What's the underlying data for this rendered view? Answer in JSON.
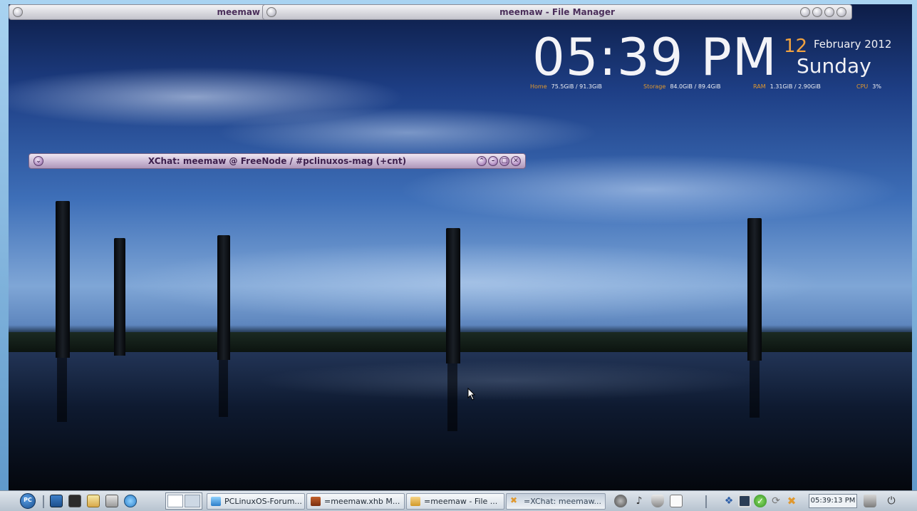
{
  "windows": {
    "meemaw_small_title": "meemaw",
    "file_manager_title": "meemaw - File Manager",
    "xchat_title": "XChat: meemaw @ FreeNode / #pclinuxos-mag (+cnt)"
  },
  "conky": {
    "time": "05:39 PM",
    "day": "12",
    "month_year": "February 2012",
    "weekday": "Sunday",
    "stats": [
      {
        "label": "Home",
        "value": "75.5GiB / 91.3GiB"
      },
      {
        "label": "Storage",
        "value": "84.0GiB / 89.4GiB"
      },
      {
        "label": "RAM",
        "value": "1.31GiB / 2.90GiB"
      },
      {
        "label": "CPU",
        "value": "3%"
      }
    ]
  },
  "taskbar": {
    "start_label": "PC",
    "tasks": [
      {
        "label": "PCLinuxOS-Forum...",
        "icon": "browser-icon"
      },
      {
        "label": "=meemaw.xhb M...",
        "icon": "homebank-icon"
      },
      {
        "label": "=meemaw - File ...",
        "icon": "folder-icon"
      },
      {
        "label": "=XChat: meemaw...",
        "icon": "xchat-icon"
      }
    ],
    "clock": "05:39:13 PM"
  },
  "colors": {
    "accent_orange": "#e0982e",
    "titlebar_purple": "#4a2e5a",
    "taskbar_bg": "#c9d2dc"
  }
}
